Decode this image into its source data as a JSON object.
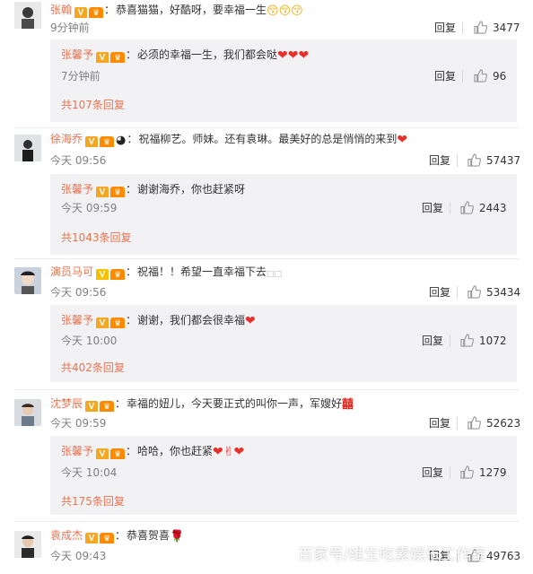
{
  "reply_label": "回复",
  "comments": [
    {
      "user": "张翰",
      "text": "恭喜猫猫，好酷呀，要幸福一生",
      "emoji": "😚😚😚",
      "time": "9分钟前",
      "likes": "3477",
      "reply": {
        "user": "张馨予",
        "text": "必须的幸福一生，我们都会哒",
        "emoji": "❤❤❤",
        "time": "7分钟前",
        "likes": "96"
      },
      "more": "共107条回复"
    },
    {
      "user": "徐海乔",
      "text": "祝福柳艺。师妹。还有袁琳。最美好的总是悄悄的来到",
      "emoji": "❤",
      "time": "今天 09:56",
      "likes": "57437",
      "reply": {
        "user": "张馨予",
        "text": "谢谢海乔，你也赶紧呀",
        "emoji": "",
        "time": "今天 09:59",
        "likes": "2443"
      },
      "more": "共1043条回复"
    },
    {
      "user": "演员马可",
      "text": "祝福！！希望一直幸福下去",
      "emoji": "",
      "time": "今天 09:56",
      "likes": "53434",
      "reply": {
        "user": "张馨予",
        "text": "谢谢，我们都会很幸福",
        "emoji": "❤",
        "time": "今天 10:00",
        "likes": "1072"
      },
      "more": "共402条回复"
    },
    {
      "user": "沈梦辰",
      "text": "幸福的妞儿，今天要正式的叫你一声，军嫂好",
      "emoji": "囍",
      "time": "今天 09:59",
      "likes": "52623",
      "reply": {
        "user": "张馨予",
        "text": "哈哈，你也赶紧",
        "emoji": "❤✌❤",
        "time": "今天 10:04",
        "likes": "1279"
      },
      "more": "共175条回复"
    },
    {
      "user": "袁成杰",
      "text": "恭喜贺喜",
      "emoji": "🌹",
      "time": "今天 09:43",
      "likes": "49763"
    }
  ],
  "watermark": "百家号/维生吃素娱乐工作室",
  "colors": {
    "username": "#eb7350",
    "reply_bg": "#f2f2f5",
    "heart": "#e8302a",
    "badge": "#f5a623"
  },
  "icons": {
    "like": "thumbs-up-icon",
    "verified": "v-badge-icon",
    "member": "vip-crown-icon"
  }
}
